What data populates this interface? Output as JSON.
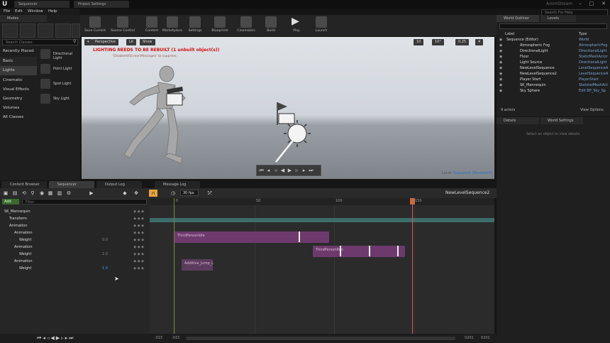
{
  "titlebar": {
    "tabs": [
      "Sequencer",
      "Project Settings"
    ],
    "app_label": "AnimStream",
    "search_placeholder": "Search For Help"
  },
  "menu": [
    "File",
    "Edit",
    "Window",
    "Help"
  ],
  "modes": {
    "title": "Modes",
    "search_placeholder": "Search Classes",
    "categories": [
      "Recently Placed",
      "Basic",
      "Lights",
      "Cinematic",
      "Visual Effects",
      "Geometry",
      "Volumes",
      "All Classes"
    ],
    "active_category": "Lights",
    "items": [
      "Directional Light",
      "Point Light",
      "Spot Light",
      "Sky Light"
    ]
  },
  "toolbar": {
    "buttons": [
      "Save Current",
      "Source Control",
      "Content",
      "Marketplace",
      "Settings",
      "Blueprints",
      "Cinematics",
      "Build",
      "Play",
      "Launch"
    ]
  },
  "viewport": {
    "perspective": "Perspective",
    "lit": "Lit",
    "show": "Show",
    "warning": "LIGHTING NEEDS TO BE REBUILT (1 unbuilt object(s))",
    "warning_sub": "'DisableAllScreenMessages' to suppress",
    "grid": "10",
    "angle": "10°",
    "scale": "0.25",
    "camera_speed": "4",
    "level_label": "Level:",
    "level_name": "Sequence (Persistent)"
  },
  "outliner": {
    "tabs": [
      "World Outliner",
      "Levels"
    ],
    "col_label": "Label",
    "col_type": "Type",
    "rows": [
      {
        "label": "Sequence (Editor)",
        "type": "World"
      },
      {
        "label": "Atmospheric Fog",
        "type": "AtmosphericFog"
      },
      {
        "label": "DirectionalLight",
        "type": "DirectionalLight"
      },
      {
        "label": "Floor",
        "type": "StaticMeshActor"
      },
      {
        "label": "Light Source",
        "type": "DirectionalLight"
      },
      {
        "label": "NewLevelSequence",
        "type": "LevelSequenceA"
      },
      {
        "label": "NewLevelSequence2",
        "type": "LevelSequenceA"
      },
      {
        "label": "Player Start",
        "type": "PlayerStart"
      },
      {
        "label": "SK_Mannequin",
        "type": "SkeletalMeshAct"
      },
      {
        "label": "Sky Sphere",
        "type": "Edit BP_Sky_Sp"
      }
    ],
    "actor_count": "9 actors",
    "view_options": "View Options"
  },
  "details": {
    "tabs": [
      "Details",
      "World Settings"
    ],
    "empty_text": "Select an object to view details."
  },
  "sequencer": {
    "tabs": [
      "Content Browser",
      "Sequencer",
      "Output Log",
      "Message Log"
    ],
    "fps": "30 fps",
    "sequence_name": "NewLevelSequence2",
    "add_label": "Add",
    "filter_placeholder": "Filter",
    "tree": [
      {
        "label": "SK_Mannequin",
        "indent": 0,
        "value": ""
      },
      {
        "label": "Transform",
        "indent": 1,
        "value": ""
      },
      {
        "label": "Animation",
        "indent": 1,
        "value": ""
      },
      {
        "label": "Animation",
        "indent": 2,
        "value": ""
      },
      {
        "label": "Weight",
        "indent": 3,
        "value": "0.0"
      },
      {
        "label": "Animation",
        "indent": 2,
        "value": ""
      },
      {
        "label": "Weight",
        "indent": 3,
        "value": "1.0"
      },
      {
        "label": "Animation",
        "indent": 2,
        "value": ""
      },
      {
        "label": "Weight",
        "indent": 3,
        "value": "1.0"
      }
    ],
    "ruler": [
      "0",
      "50",
      "100",
      "150"
    ],
    "sections": [
      "ThirdPersonIdle",
      "ThirdPersonRun",
      "Additive_Jump_L"
    ],
    "range_start": "-015",
    "range_start2": "-015",
    "range_end": "0201",
    "range_end2": "0201"
  },
  "colors": {
    "accent": "#e8a33a",
    "section": "#6e3a6e",
    "playhead": "#d9534f",
    "warning": "#d01010"
  }
}
